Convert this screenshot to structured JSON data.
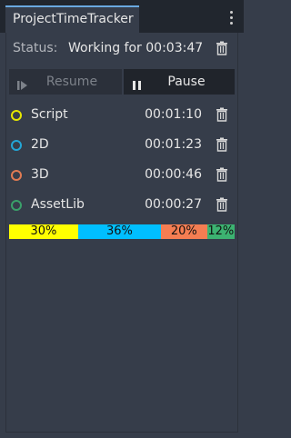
{
  "tab": {
    "title": "ProjectTimeTracker"
  },
  "status": {
    "label": "Status:",
    "value": "Working for 00:03:47"
  },
  "controls": {
    "resume_label": "Resume",
    "pause_label": "Pause"
  },
  "categories": [
    {
      "name": "Script",
      "time": "00:01:10",
      "color": "#e6e600"
    },
    {
      "name": "2D",
      "time": "00:01:23",
      "color": "#23a6d6"
    },
    {
      "name": "3D",
      "time": "00:00:46",
      "color": "#e07b53"
    },
    {
      "name": "AssetLib",
      "time": "00:00:27",
      "color": "#3aa06a"
    }
  ],
  "distribution": [
    {
      "label": "30%",
      "fraction": 0.3,
      "color": "#ffff00"
    },
    {
      "label": "36%",
      "fraction": 0.36,
      "color": "#00bfff"
    },
    {
      "label": "20%",
      "fraction": 0.2,
      "color": "#f47d52"
    },
    {
      "label": "12%",
      "fraction": 0.12,
      "color": "#3cb371"
    }
  ]
}
